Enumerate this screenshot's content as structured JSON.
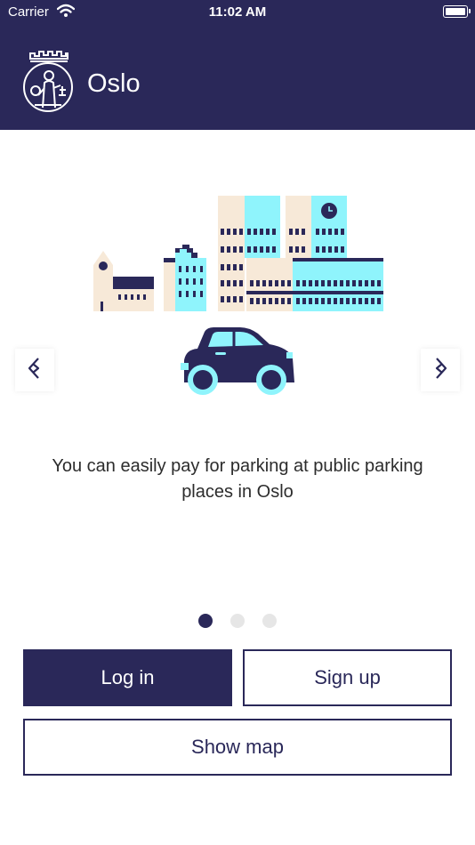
{
  "status_bar": {
    "carrier": "Carrier",
    "time": "11:02 AM"
  },
  "header": {
    "app_name": "Oslo"
  },
  "carousel": {
    "caption": "You can easily pay for parking at public parking places in Oslo",
    "page_count": 3,
    "active_page": 1
  },
  "actions": {
    "login_label": "Log in",
    "signup_label": "Sign up",
    "map_label": "Show map"
  },
  "colors": {
    "brand_dark": "#2a2859",
    "accent_cyan": "#8ff4fc",
    "beige": "#f7e9d8",
    "dot_inactive": "#e6e6e6"
  }
}
